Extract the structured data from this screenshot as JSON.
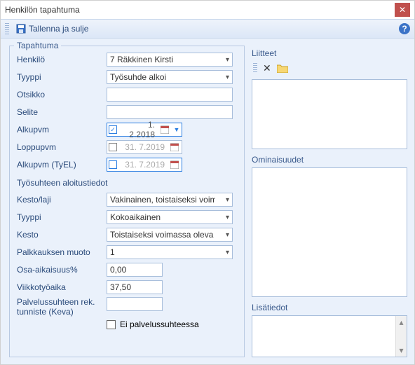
{
  "window": {
    "title": "Henkilön tapahtuma"
  },
  "toolbar": {
    "save_close": "Tallenna ja sulje"
  },
  "tapahtuma": {
    "legend": "Tapahtuma",
    "henkilo_label": "Henkilö",
    "henkilo_value": "7 Räkkinen Kirsti",
    "tyyppi_label": "Tyyppi",
    "tyyppi_value": "Työsuhde alkoi",
    "otsikko_label": "Otsikko",
    "otsikko_value": "",
    "selite_label": "Selite",
    "selite_value": "",
    "alkupvm_label": "Alkupvm",
    "alkupvm_value": "1.  2.2018",
    "loppupvm_label": "Loppupvm",
    "loppupvm_value": "31.  7.2019",
    "alkupvm_tyel_label": "Alkupvm (TyEL)",
    "alkupvm_tyel_value": "31.  7.2019"
  },
  "aloitus": {
    "section_title": "Työsuhteen aloitustiedot",
    "kesto_laji_label": "Kesto/laji",
    "kesto_laji_value": "Vakinainen, toistaiseksi voimassa",
    "tyyppi_label": "Tyyppi",
    "tyyppi_value": "Kokoaikainen",
    "kesto_label": "Kesto",
    "kesto_value": "Toistaiseksi voimassa oleva",
    "palkkaus_label": "Palkkauksen muoto",
    "palkkaus_value": "1",
    "osaaika_label": "Osa-aikaisuus%",
    "osaaika_value": "0,00",
    "viikko_label": "Viikkotyöaika",
    "viikko_value": "37,50",
    "keva_label": "Palvelussuhteen rek. tunniste (Keva)",
    "keva_value": "",
    "ei_palv_label": "Ei palvelussuhteessa"
  },
  "right": {
    "liitteet": "Liitteet",
    "ominaisuudet": "Ominaisuudet",
    "lisatiedot": "Lisätiedot"
  }
}
